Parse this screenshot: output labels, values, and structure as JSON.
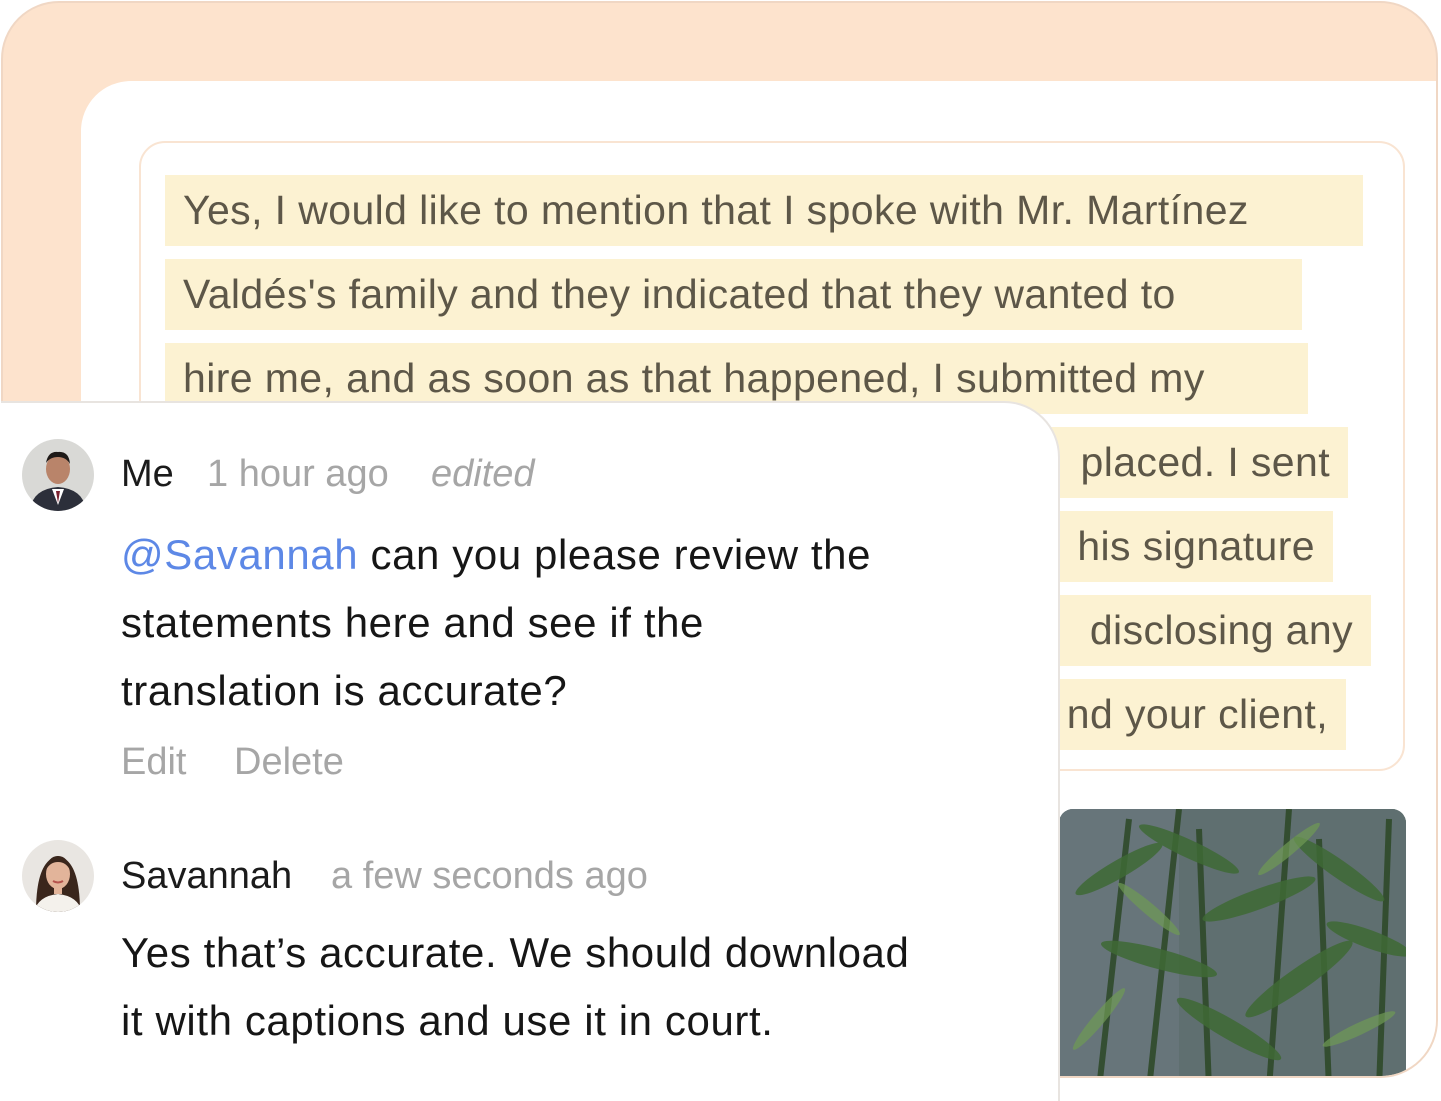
{
  "transcript": {
    "lines": [
      "Yes, I would like to mention that I spoke with Mr. Martínez",
      "Valdés's family and they indicated that they wanted to",
      "hire me, and as soon as that happened, I submitted my",
      "placed. I sent",
      "his signature",
      "disclosing any",
      "nd your client,"
    ]
  },
  "comments": [
    {
      "author": "Me",
      "time": "1 hour ago",
      "edited_label": "edited",
      "mention": "@Savannah",
      "text_parts": [
        " can you please review the",
        "statements here and see if the",
        "translation is accurate?"
      ],
      "actions": {
        "edit": "Edit",
        "delete": "Delete"
      }
    },
    {
      "author": "Savannah",
      "time": "a few seconds ago",
      "text_parts": [
        "Yes that’s accurate. We should download",
        "it with captions and use it in court."
      ]
    }
  ],
  "colors": {
    "frame": "#fde3cd",
    "highlight": "#fcf2d2",
    "mention": "#5d88e6",
    "muted": "#a6a6a6"
  },
  "icons": [
    "avatar-me",
    "avatar-savannah"
  ]
}
